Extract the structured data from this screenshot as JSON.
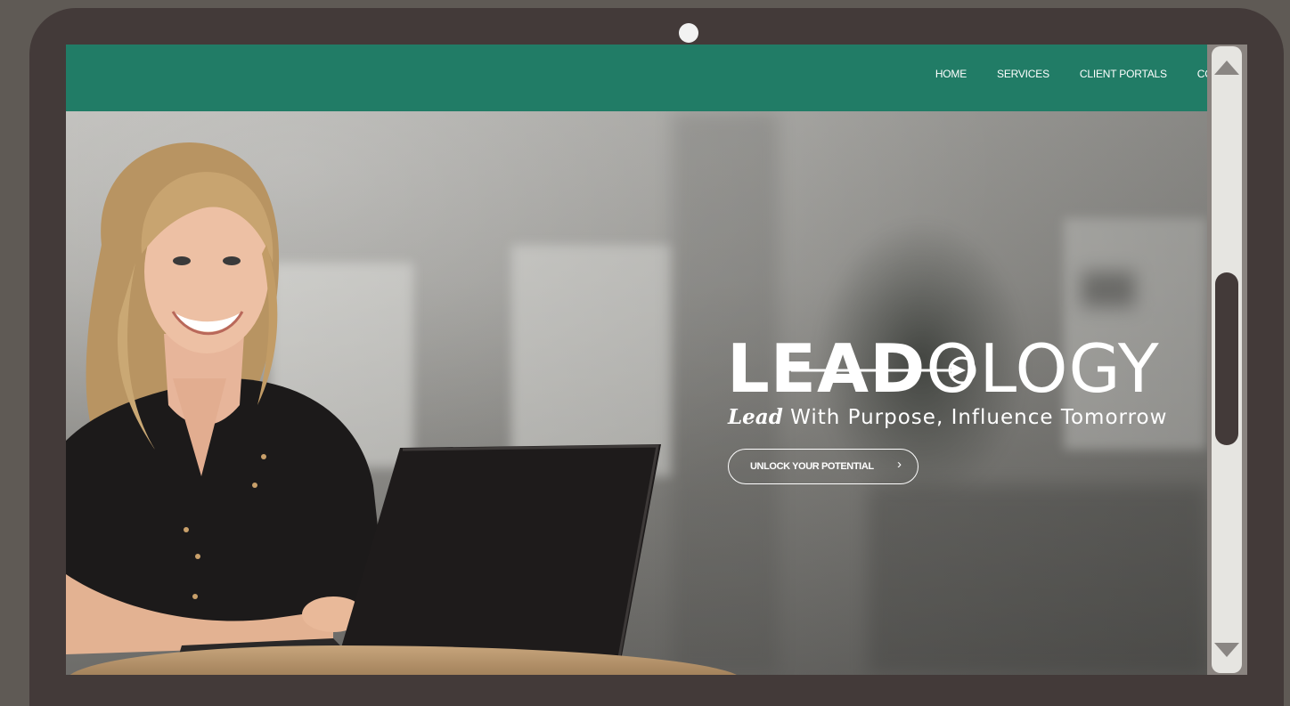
{
  "nav": {
    "items": [
      {
        "label": "HOME"
      },
      {
        "label": "SERVICES"
      },
      {
        "label": "CLIENT PORTALS"
      },
      {
        "label": "CONT"
      }
    ]
  },
  "hero": {
    "logo_part1": "LEAD",
    "logo_part2": "OLOGY",
    "tagline_lead": "Lead",
    "tagline_rest": " With Purpose, Influence Tomorrow",
    "cta_label": "UNLOCK YOUR POTENTIAL",
    "cta_chevron": "›"
  },
  "colors": {
    "nav_background": "#217c66",
    "bezel": "#433a39",
    "scroll_track": "#e6e5e1",
    "scroll_thumb": "#433a39"
  },
  "icons": {
    "camera": "camera-icon",
    "scroll_up": "scroll-up-arrow-icon",
    "scroll_down": "scroll-down-arrow-icon",
    "logo_arrow": "arrow-right-icon"
  }
}
